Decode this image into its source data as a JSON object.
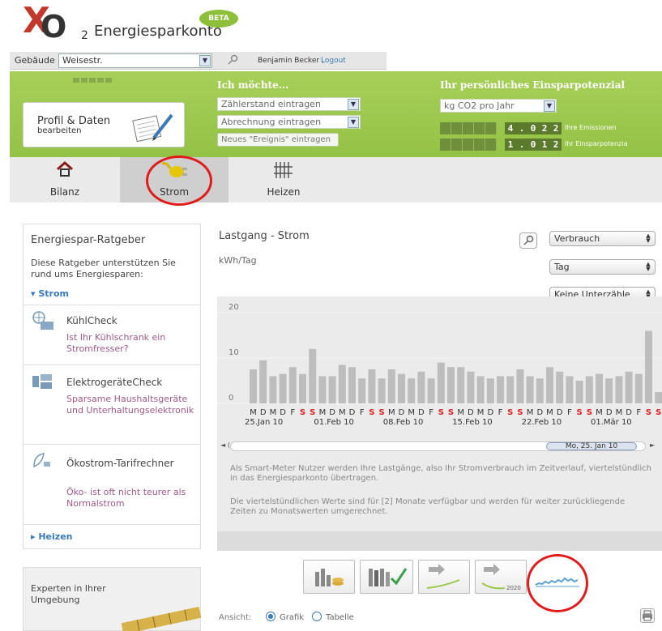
{
  "header": {
    "logo_x": "X",
    "logo_o": "O",
    "logo_two": "2",
    "app_name": "Energiesparkonto",
    "beta_badge": "BETA"
  },
  "topbar": {
    "building_label": "Gebäude",
    "building_value": "Weisestr.",
    "user_name": "Benjamin Becker ,",
    "logout": "Logout"
  },
  "profile": {
    "title": "Profil & Daten",
    "subtitle": "bearbeiten"
  },
  "actions": {
    "heading": "Ich möchte...",
    "zaehlerstand": "Zählerstand eintragen",
    "abrechnung": "Abrechnung eintragen",
    "ereignis": "Neues \"Ereignis\" eintragen"
  },
  "potential": {
    "heading": "Ihr persönliches Einsparpotenzial",
    "unit": "kg CO2 pro Jahr",
    "emissions_digits": [
      "4",
      ".",
      "0",
      "2",
      "2"
    ],
    "emissions_label": "Ihre Emissionen",
    "einspar_digits": [
      "1",
      ".",
      "0",
      "1",
      "2"
    ],
    "einspar_label": "Ihr Einsparpotenzia"
  },
  "tabs": [
    {
      "label": "Bilanz",
      "active": false
    },
    {
      "label": "Strom",
      "active": true
    },
    {
      "label": "Heizen",
      "active": false
    }
  ],
  "sidebar": {
    "title": "Energiespar-Ratgeber",
    "intro": "Diese Ratgeber unterstützen Sie rund ums Energiesparen:",
    "strom_toggle": "▾ Strom",
    "items": [
      {
        "title": "KühlCheck",
        "desc": "Ist Ihr Kühlschrank ein Stromfresser?"
      },
      {
        "title": "ElektrogeräteCheck",
        "desc": "Sparsame Haushaltsgeräte und Unterhaltungselektronik"
      },
      {
        "title": "Ökostrom-Tarifrechner",
        "desc": "Öko- ist oft nicht teurer als Normalstrom"
      }
    ],
    "heizen_toggle": "▸ Heizen",
    "experten": "Experten in Ihrer Umgebung"
  },
  "chart_controls": {
    "title": "Lastgang - Strom",
    "unit": "kWh/Tag",
    "mode": "Verbrauch",
    "granularity": "Tag",
    "submeter": "Keine Unterzähle"
  },
  "chart_data": {
    "type": "bar",
    "ylabel": "kWh/Tag",
    "yticks": [
      0,
      10,
      20
    ],
    "ylim": [
      0,
      20
    ],
    "day_letters": [
      "M",
      "D",
      "M",
      "D",
      "F",
      "S",
      "S",
      "M",
      "D",
      "M",
      "D",
      "F",
      "S",
      "S",
      "M",
      "D",
      "M",
      "D",
      "F",
      "S",
      "S",
      "M",
      "D",
      "M",
      "D",
      "F",
      "S",
      "S",
      "M",
      "D",
      "M",
      "D",
      "F",
      "S",
      "S",
      "M",
      "D",
      "M",
      "D",
      "F",
      "S",
      "S"
    ],
    "weekend_color": "#e02020",
    "bar_color": "#bdbdbd",
    "values": [
      7.5,
      9.5,
      6,
      6.5,
      8,
      6.5,
      12,
      6,
      6,
      8.5,
      8,
      5.5,
      7.5,
      5.5,
      7.5,
      6.5,
      5.5,
      7,
      5.5,
      9,
      8,
      8,
      7,
      6,
      5.5,
      6,
      6,
      7.5,
      6,
      5.5,
      8,
      7,
      6,
      5,
      6,
      6.5,
      5.5,
      6,
      7,
      6.5,
      16,
      2.5
    ],
    "date_labels": [
      "25.Jan 10",
      "01.Feb 10",
      "08.Feb 10",
      "15.Feb 10",
      "22.Feb 10",
      "01.Mär 10"
    ]
  },
  "scroll": {
    "thumb_label": "Mo, 25. Jan 10"
  },
  "info": {
    "p1": "Als Smart-Meter Nutzer werden Ihre Lastgänge, also Ihr Stromverbrauch im Zeitverlauf, viertelstündlich in das Energiesparkonto übertragen.",
    "p2": "Die viertelstündlichen Werte sind für [2] Monate verfügbar und werden für weiter zurückliegende Zeiten zu Monatswerten umgerechnet."
  },
  "views": {
    "prognose_year": "2020"
  },
  "ansicht": {
    "label": "Ansicht:",
    "grafik": "Grafik",
    "tabelle": "Tabelle"
  },
  "colors": {
    "green": "#9bc84c",
    "link_blue": "#3a7ab8",
    "annotation_red": "#e01b1b"
  }
}
